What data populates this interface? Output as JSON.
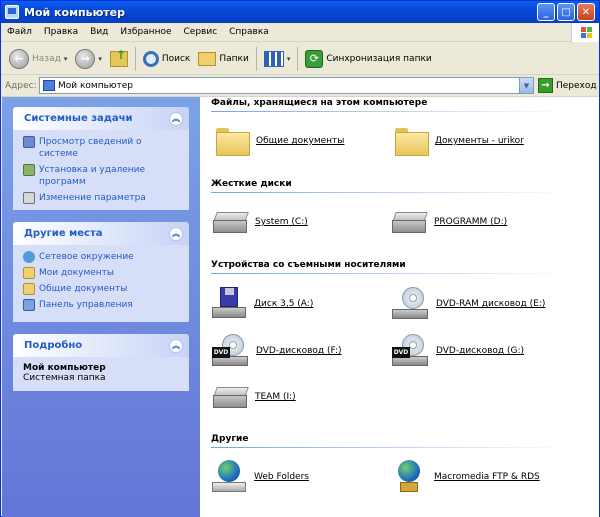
{
  "window": {
    "title": "Мой компьютер"
  },
  "menu": [
    "Файл",
    "Правка",
    "Вид",
    "Избранное",
    "Сервис",
    "Справка"
  ],
  "toolbar": {
    "back": "Назад",
    "search": "Поиск",
    "folders": "Папки",
    "sync": "Синхронизация папки"
  },
  "address": {
    "label": "Адрес:",
    "value": "Мой компьютер",
    "go": "Переход"
  },
  "left": {
    "system_tasks": {
      "title": "Системные задачи",
      "items": [
        "Просмотр сведений о системе",
        "Установка и удаление программ",
        "Изменение параметра"
      ]
    },
    "other_places": {
      "title": "Другие места",
      "items": [
        "Сетевое окружение",
        "Мои документы",
        "Общие документы",
        "Панель управления"
      ]
    },
    "details": {
      "title": "Подробно",
      "name": "Мой компьютер",
      "sub": "Системная папка"
    }
  },
  "groups": {
    "files": {
      "title": "Файлы, хранящиеся на этом компьютере",
      "items": [
        "Общие документы",
        "Документы - urikor"
      ]
    },
    "hdd": {
      "title": "Жесткие диски",
      "items": [
        "System (C:)",
        "PROGRAMM (D:)"
      ]
    },
    "removable": {
      "title": "Устройства со съемными носителями",
      "items": [
        "Диск 3,5 (A:)",
        "DVD-RAM дисковод (E:)",
        "DVD-дисковод (F:)",
        "DVD-дисковод (G:)",
        "TEAM (I:)"
      ]
    },
    "other": {
      "title": "Другие",
      "items": [
        "Web Folders",
        "Macromedia FTP & RDS"
      ]
    }
  },
  "colors": {
    "accent": "#215dc6",
    "title_bar": "#0849d6",
    "left_pane": "#6375d6"
  }
}
